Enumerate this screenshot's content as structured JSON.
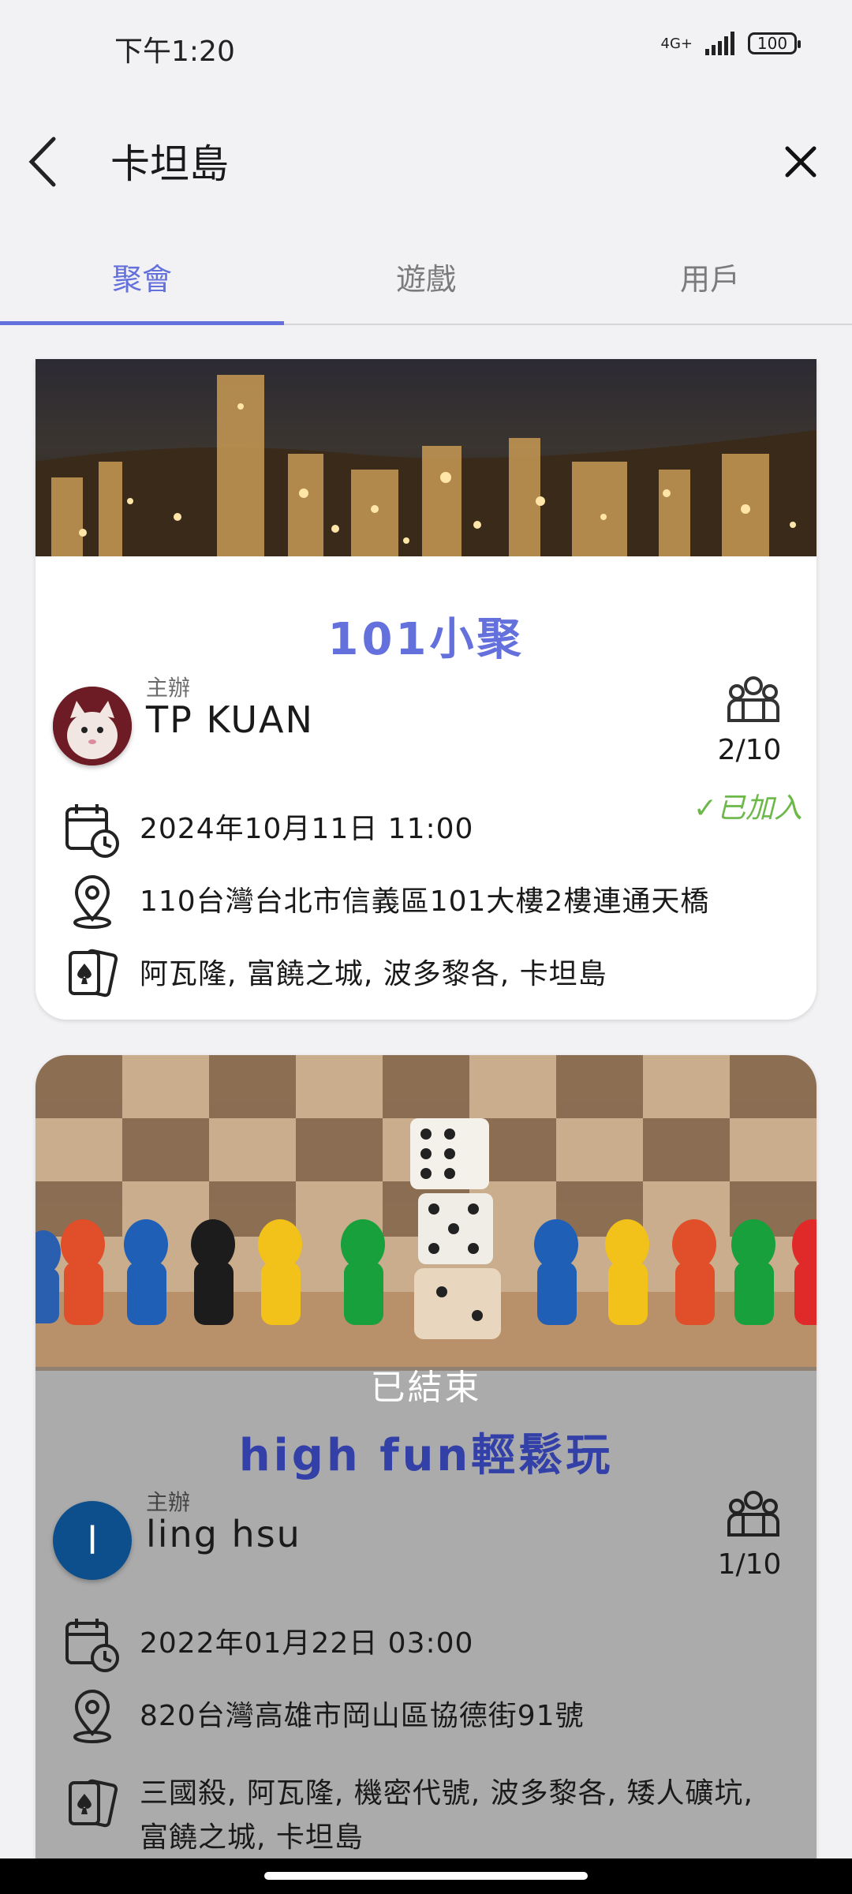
{
  "status_bar": {
    "time": "下午1:20",
    "network": "4G+",
    "battery": "100"
  },
  "search": {
    "query": "卡坦島"
  },
  "tabs": [
    {
      "label": "聚會",
      "active": true
    },
    {
      "label": "遊戲",
      "active": false
    },
    {
      "label": "用戶",
      "active": false
    }
  ],
  "events": [
    {
      "title": "101小聚",
      "host_label": "主辦",
      "host_name": "TP KUAN",
      "participants": "2/10",
      "status": "✓已加入",
      "date": "2024年10月11日 11:00",
      "location": "110台灣台北市信義區101大樓2樓連通天橋",
      "games": "阿瓦隆, 富饒之城, 波多黎各, 卡坦島",
      "title_color": "#6470dc"
    },
    {
      "title": "high fun輕鬆玩",
      "host_label": "主辦",
      "host_name": "ling hsu",
      "host_initial": "l",
      "participants": "1/10",
      "ended_label": "已結束",
      "date": "2022年01月22日 03:00",
      "location": "820台灣高雄市岡山區協德街91號",
      "games": "三國殺, 阿瓦隆, 機密代號, 波多黎各, 矮人礦坑, 富饒之城, 卡坦島",
      "title_color": "#3340a8"
    }
  ],
  "colors": {
    "accent": "#6470dc",
    "joined": "#6cb94a",
    "avatar_blue": "#0d4f8c"
  }
}
